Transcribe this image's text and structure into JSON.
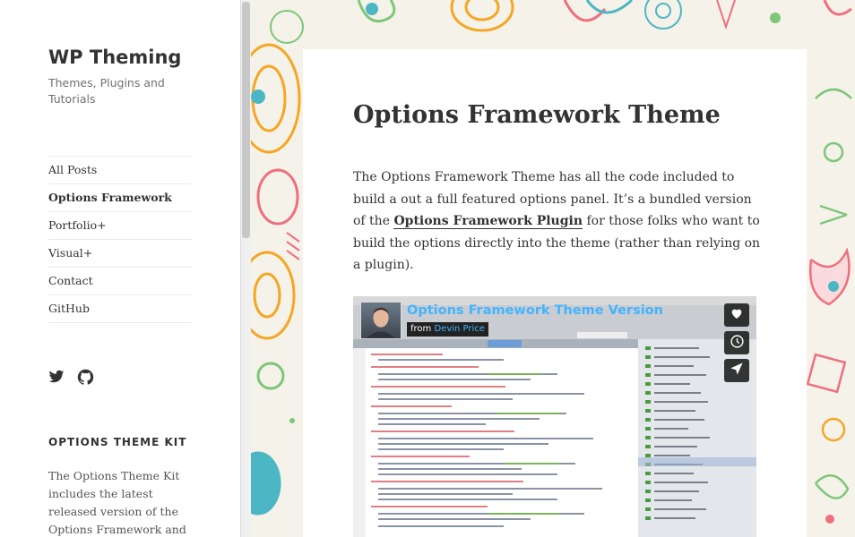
{
  "site": {
    "title": "WP Theming",
    "description": "Themes, Plugins and Tutorials"
  },
  "nav": {
    "items": [
      {
        "label": "All Posts"
      },
      {
        "label": "Options Framework"
      },
      {
        "label": "Portfolio+"
      },
      {
        "label": "Visual+"
      },
      {
        "label": "Contact"
      },
      {
        "label": "GitHub"
      }
    ]
  },
  "social": {
    "icons": [
      "twitter-icon",
      "github-icon"
    ]
  },
  "widget": {
    "title": "OPTIONS THEME KIT",
    "text": "The Options Theme Kit includes the latest released version of the Options Framework and a"
  },
  "post": {
    "title": "Options Framework Theme",
    "body_before": "The Options Framework Theme has all the code included to build a out a full featured options panel. It’s a bundled version of the ",
    "link": "Options Framework Plugin",
    "body_after": " for those folks who want to build the options directly into the theme (rather than relying on a plugin)."
  },
  "video": {
    "title": "Options Framework Theme Version",
    "from_label": "from",
    "author": "Devin Price",
    "buttons": [
      "heart-icon",
      "clock-icon",
      "send-icon"
    ]
  },
  "colors": {
    "accent_blue": "#44b4ff",
    "pattern_orange": "#f5a623",
    "pattern_green": "#7dc67a",
    "pattern_pink": "#ef6f7c",
    "pattern_teal": "#4bb7c4"
  }
}
